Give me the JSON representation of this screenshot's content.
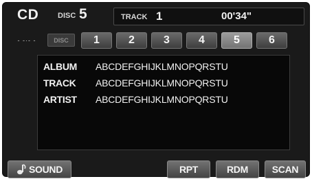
{
  "header": {
    "source": "CD",
    "disc_label": "DISC",
    "disc_number": "5",
    "track_label": "TRACK",
    "track_number": "1",
    "elapsed_time": "00'34\""
  },
  "disc_row": {
    "slot_indicator": "- -·- -",
    "disc_tag": "DISC",
    "discs": [
      "1",
      "2",
      "3",
      "4",
      "5",
      "6"
    ],
    "selected_disc": "5"
  },
  "info": {
    "rows": [
      {
        "label": "ALBUM",
        "value": "ABCDEFGHIJKLMNOPQRSTU"
      },
      {
        "label": "TRACK",
        "value": "ABCDEFGHIJKLMNOPQRSTU"
      },
      {
        "label": "ARTIST",
        "value": "ABCDEFGHIJKLMNOPQRSTU"
      }
    ]
  },
  "bottom_bar": {
    "sound_label": "SOUND",
    "sound_icon": "note-icon",
    "rpt_label": "RPT",
    "rdm_label": "RDM",
    "scan_label": "SCAN"
  }
}
